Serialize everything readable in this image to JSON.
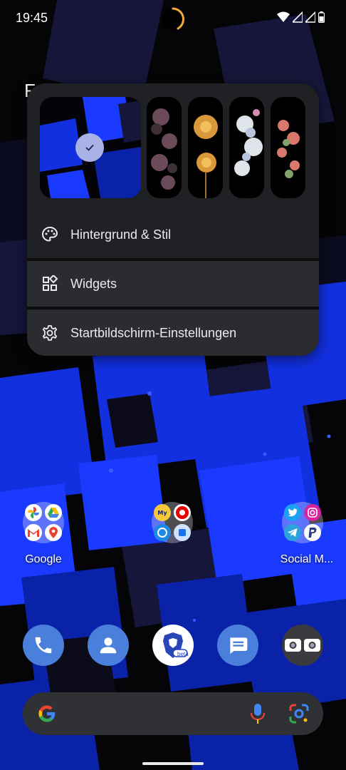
{
  "status_bar": {
    "time": "19:45"
  },
  "popup": {
    "wallpapers": [
      {
        "name": "current-blue-wallpaper",
        "selected": true
      },
      {
        "name": "dark-flowers-wallpaper",
        "selected": false
      },
      {
        "name": "yellow-flower-wallpaper",
        "selected": false
      },
      {
        "name": "white-blossom-wallpaper",
        "selected": false
      },
      {
        "name": "pink-flowers-wallpaper",
        "selected": false
      }
    ],
    "items": [
      {
        "label": "Hintergrund & Stil",
        "icon": "palette-icon"
      },
      {
        "label": "Widgets",
        "icon": "widgets-icon"
      },
      {
        "label": "Startbildschirm-Einstellungen",
        "icon": "gear-icon"
      }
    ]
  },
  "home": {
    "folders": [
      {
        "label": "Google"
      },
      {
        "label": ""
      },
      {
        "label": "Social M..."
      }
    ],
    "dock": [
      "phone-icon",
      "contacts-icon",
      "brave-beta-icon",
      "messages-icon",
      "camera-icon"
    ],
    "brave_badge": "beta",
    "partial_text": "F"
  },
  "colors": {
    "accent": "#1a73e8",
    "popup_bg": "#202124",
    "wallpaper_blue": "#1a3bff"
  }
}
